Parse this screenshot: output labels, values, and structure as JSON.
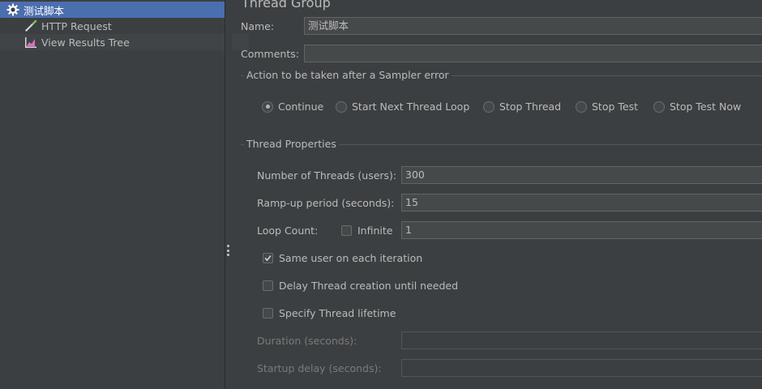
{
  "tree": {
    "items": [
      {
        "label": "测试脚本",
        "icon": "gear-icon"
      },
      {
        "label": "HTTP Request",
        "icon": "pipette-icon"
      },
      {
        "label": "View Results Tree",
        "icon": "results-chart-icon"
      }
    ]
  },
  "panel": {
    "title": "Thread Group",
    "name_label": "Name:",
    "name_value": "测试脚本",
    "comments_label": "Comments:",
    "comments_value": "",
    "sampler_error": {
      "title": "Action to be taken after a Sampler error",
      "options": [
        "Continue",
        "Start Next Thread Loop",
        "Stop Thread",
        "Stop Test",
        "Stop Test Now"
      ],
      "selected": "Continue"
    },
    "thread_props": {
      "title": "Thread Properties",
      "threads_label": "Number of Threads (users):",
      "threads_value": "300",
      "rampup_label": "Ramp-up period (seconds):",
      "rampup_value": "15",
      "loop_label": "Loop Count:",
      "infinite_label": "Infinite",
      "infinite_checked": false,
      "loop_value": "1",
      "same_user_label": "Same user on each iteration",
      "same_user_checked": true,
      "delay_label": "Delay Thread creation until needed",
      "delay_checked": false,
      "lifetime_label": "Specify Thread lifetime",
      "lifetime_checked": false,
      "duration_label": "Duration (seconds):",
      "duration_value": "",
      "startup_label": "Startup delay (seconds):",
      "startup_value": ""
    }
  },
  "colors": {
    "background": "#3c3f41",
    "selection": "#4b6eaf",
    "text": "#bbbbbb",
    "field_bg": "#45494a"
  }
}
